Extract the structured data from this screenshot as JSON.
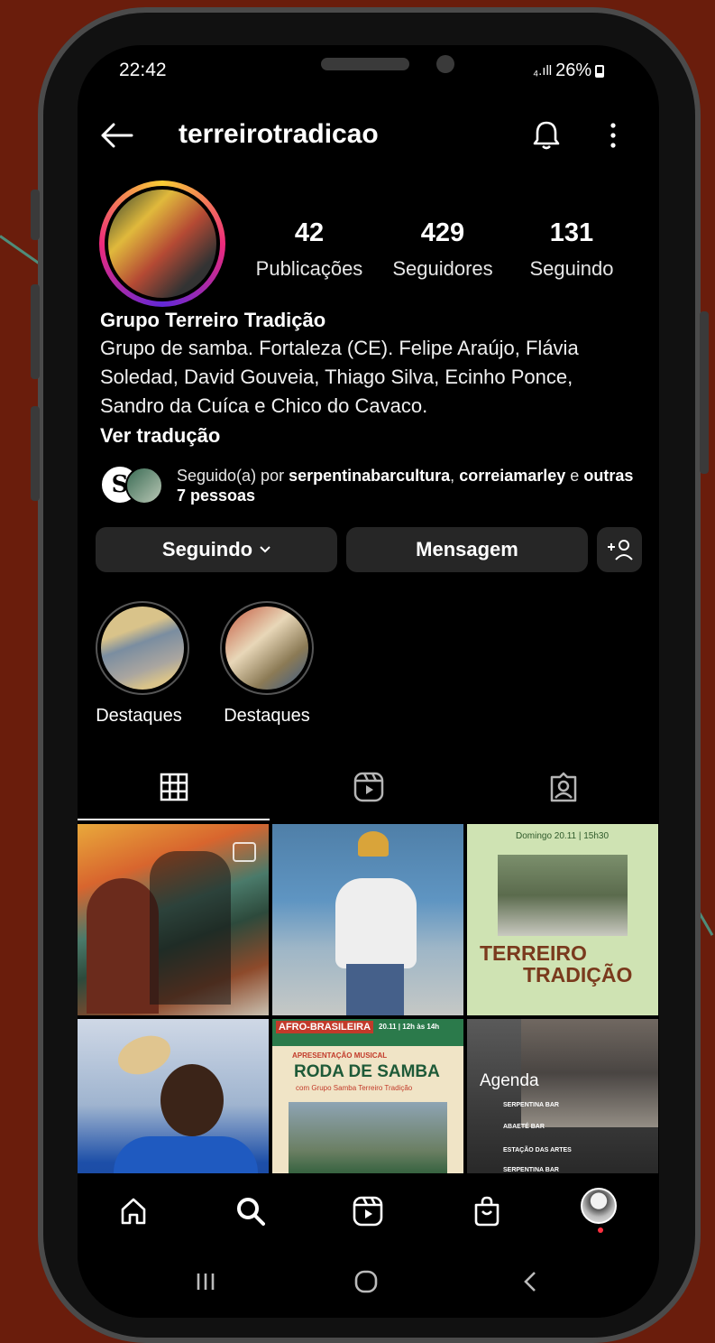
{
  "status": {
    "time": "22:42",
    "signal": "₄.ıll",
    "battery": "26%"
  },
  "header": {
    "back_icon": "arrow-left-icon",
    "username": "terreirotradicao",
    "bell_icon": "bell-icon",
    "menu_icon": "more-vertical-icon"
  },
  "stats": [
    {
      "value": "42",
      "label": "Publicações"
    },
    {
      "value": "429",
      "label": "Seguidores"
    },
    {
      "value": "131",
      "label": "Seguindo"
    }
  ],
  "bio": {
    "name": "Grupo Terreiro Tradição",
    "text": "Grupo de samba. Fortaleza (CE). Felipe Araújo, Flávia Soledad, David Gouveia, Thiago Silva, Ecinho Ponce, Sandro da Cuíca e Chico do Cavaco.",
    "see_translation": "Ver tradução"
  },
  "followed_by": {
    "prefix": "Seguido(a) por",
    "user1": "serpentinabarcultura",
    "sep": ",",
    "user2": "correiamarley",
    "and": "e",
    "others": "outras 7 pessoas",
    "avatar1_letter": "S"
  },
  "actions": {
    "following": "Seguindo",
    "message": "Mensagem",
    "add_user": "+♀"
  },
  "highlights": [
    {
      "label": "Destaques"
    },
    {
      "label": "Destaques"
    }
  ],
  "tabs": [
    "grid-icon",
    "reels-icon",
    "tagged-icon"
  ],
  "posts": {
    "post3_date": "Domingo 20.11 | 15h30",
    "post3_title1": "TERREIRO",
    "post3_title2": "TRADIÇÃO",
    "post5_tag": "AFRO-BRASILEIRA",
    "post5_date": "20.11 | 12h às 14h",
    "post5_kicker": "APRESENTAÇÃO MUSICAL",
    "post5_title": "RODA DE SAMBA",
    "post5_sub": "com Grupo Samba Terreiro Tradição",
    "post6_title": "Agenda",
    "post6_items": [
      "SERPENTINA BAR",
      "ABAETÉ BAR",
      "ESTAÇÃO DAS ARTES",
      "SERPENTINA BAR"
    ]
  },
  "bottom_nav": [
    "home-icon",
    "search-icon",
    "reels-icon",
    "shop-icon",
    "profile-avatar"
  ],
  "system_nav": [
    "recents-icon",
    "home-circle-icon",
    "back-chevron-icon"
  ]
}
